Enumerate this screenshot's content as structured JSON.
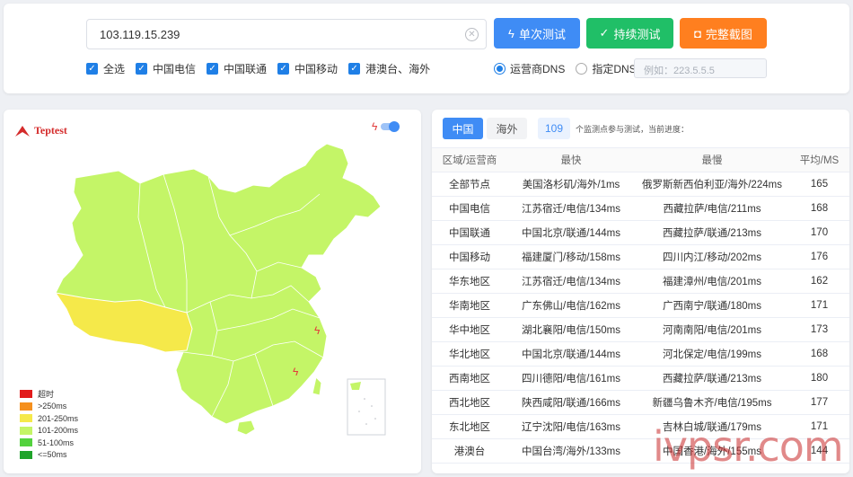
{
  "search": {
    "ip_value": "103.119.15.239"
  },
  "buttons": {
    "single": "单次测试",
    "continuous": "持续测试",
    "screenshot": "完整截图"
  },
  "filters": [
    {
      "label": "全选",
      "checked": true
    },
    {
      "label": "中国电信",
      "checked": true
    },
    {
      "label": "中国联通",
      "checked": true
    },
    {
      "label": "中国移动",
      "checked": true
    },
    {
      "label": "港澳台、海外",
      "checked": true
    }
  ],
  "dns": {
    "isp_label": "运营商DNS",
    "custom_label": "指定DNS:",
    "placeholder": "例如：223.5.5.5",
    "selected": "isp"
  },
  "map": {
    "logo_text": "Teptest",
    "legend": [
      {
        "label": "超时",
        "color": "#e21b1b"
      },
      {
        "label": ">250ms",
        "color": "#f5901e"
      },
      {
        "label": "201-250ms",
        "color": "#f5e94a"
      },
      {
        "label": "101-200ms",
        "color": "#c4f567"
      },
      {
        "label": "51-100ms",
        "color": "#53d23e"
      },
      {
        "label": "<=50ms",
        "color": "#1fa32a"
      }
    ],
    "colors": {
      "main": "#c4f567",
      "tibet": "#f5e94a",
      "border": "#ffffff"
    }
  },
  "results": {
    "tabs": {
      "china": "中国",
      "overseas": "海外"
    },
    "node_count": "109",
    "count_text": "个监测点参与测试，当前进度：",
    "headers": [
      "区域/运营商",
      "最快",
      "最慢",
      "平均/MS"
    ],
    "rows": [
      [
        "全部节点",
        "美国洛杉矶/海外/1ms",
        "俄罗斯新西伯利亚/海外/224ms",
        "165"
      ],
      [
        "中国电信",
        "江苏宿迁/电信/134ms",
        "西藏拉萨/电信/211ms",
        "168"
      ],
      [
        "中国联通",
        "中国北京/联通/144ms",
        "西藏拉萨/联通/213ms",
        "170"
      ],
      [
        "中国移动",
        "福建厦门/移动/158ms",
        "四川内江/移动/202ms",
        "176"
      ],
      [
        "华东地区",
        "江苏宿迁/电信/134ms",
        "福建漳州/电信/201ms",
        "162"
      ],
      [
        "华南地区",
        "广东佛山/电信/162ms",
        "广西南宁/联通/180ms",
        "171"
      ],
      [
        "华中地区",
        "湖北襄阳/电信/150ms",
        "河南南阳/电信/201ms",
        "173"
      ],
      [
        "华北地区",
        "中国北京/联通/144ms",
        "河北保定/电信/199ms",
        "168"
      ],
      [
        "西南地区",
        "四川德阳/电信/161ms",
        "西藏拉萨/联通/213ms",
        "180"
      ],
      [
        "西北地区",
        "陕西咸阳/联通/166ms",
        "新疆乌鲁木齐/电信/195ms",
        "177"
      ],
      [
        "东北地区",
        "辽宁沈阳/电信/163ms",
        "吉林白城/联通/179ms",
        "171"
      ],
      [
        "港澳台",
        "中国台湾/海外/133ms",
        "中国香港/海外/155ms",
        "144"
      ]
    ]
  },
  "watermark": "ivpsr.com"
}
